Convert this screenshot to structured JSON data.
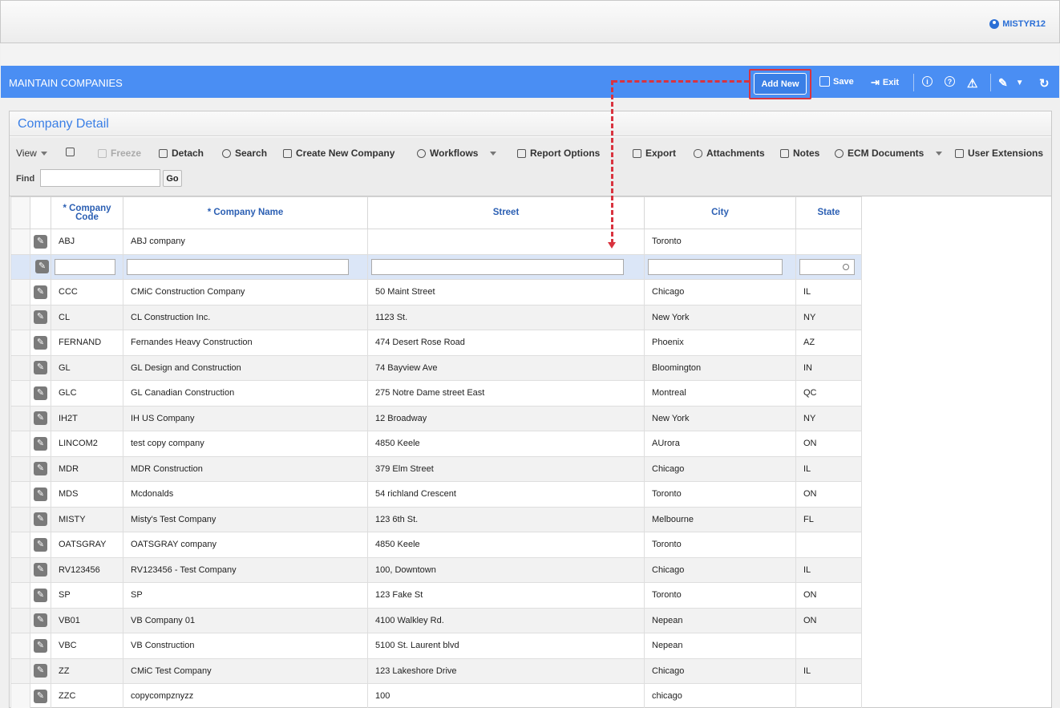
{
  "header": {
    "username": "MISTYR12"
  },
  "titlebar": {
    "title": "MAINTAIN COMPANIES",
    "add_new": "Add New",
    "save": "Save",
    "exit": "Exit"
  },
  "panel": {
    "title": "Company Detail"
  },
  "toolbar": {
    "view": "View",
    "freeze": "Freeze",
    "detach": "Detach",
    "search": "Search",
    "create_new_company": "Create New Company",
    "workflows": "Workflows",
    "report_options": "Report Options",
    "export": "Export",
    "attachments": "Attachments",
    "notes": "Notes",
    "ecm_documents": "ECM Documents",
    "user_extensions": "User Extensions",
    "find_label": "Find",
    "find_value": "",
    "go": "Go"
  },
  "table": {
    "columns": [
      "* Company Code",
      "* Company Name",
      "Street",
      "City",
      "State"
    ],
    "rows": [
      {
        "code": "ABJ",
        "name": "ABJ company",
        "street": "",
        "city": "Toronto",
        "state": ""
      },
      {
        "code": "CCC",
        "name": "CMiC Construction Company",
        "street": "50 Maint Street",
        "city": "Chicago",
        "state": "IL"
      },
      {
        "code": "CL",
        "name": "CL Construction Inc.",
        "street": "1123 St.",
        "city": "New York",
        "state": "NY"
      },
      {
        "code": "FERNAND",
        "name": "Fernandes Heavy Construction",
        "street": "474 Desert Rose Road",
        "city": "Phoenix",
        "state": "AZ"
      },
      {
        "code": "GL",
        "name": "GL Design and Construction",
        "street": "74 Bayview Ave",
        "city": "Bloomington",
        "state": "IN"
      },
      {
        "code": "GLC",
        "name": "GL Canadian Construction",
        "street": "275 Notre Dame street East",
        "city": "Montreal",
        "state": "QC"
      },
      {
        "code": "IH2T",
        "name": "IH US Company",
        "street": "12 Broadway",
        "city": "New York",
        "state": "NY"
      },
      {
        "code": "LINCOM2",
        "name": "test copy company",
        "street": "4850 Keele",
        "city": "AUrora",
        "state": "ON"
      },
      {
        "code": "MDR",
        "name": "MDR Construction",
        "street": "379 Elm Street",
        "city": "Chicago",
        "state": "IL"
      },
      {
        "code": "MDS",
        "name": "Mcdonalds",
        "street": "54 richland Crescent",
        "city": "Toronto",
        "state": "ON"
      },
      {
        "code": "MISTY",
        "name": "Misty's Test Company",
        "street": "123 6th St.",
        "city": "Melbourne",
        "state": "FL"
      },
      {
        "code": "OATSGRAY",
        "name": "OATSGRAY company",
        "street": "4850 Keele",
        "city": "Toronto",
        "state": ""
      },
      {
        "code": "RV123456",
        "name": "RV123456 - Test Company",
        "street": "100, Downtown",
        "city": "Chicago",
        "state": "IL"
      },
      {
        "code": "SP",
        "name": "SP",
        "street": "123 Fake St",
        "city": "Toronto",
        "state": "ON"
      },
      {
        "code": "VB01",
        "name": "VB Company 01",
        "street": "4100 Walkley Rd.",
        "city": "Nepean",
        "state": "ON"
      },
      {
        "code": "VBC",
        "name": "VB Construction",
        "street": "5100 St. Laurent blvd",
        "city": "Nepean",
        "state": ""
      },
      {
        "code": "ZZ",
        "name": "CMiC Test Company",
        "street": "123 Lakeshore Drive",
        "city": "Chicago",
        "state": "IL"
      },
      {
        "code": "ZZC",
        "name": "copycompznyzz",
        "street": "100",
        "city": "chicago",
        "state": ""
      }
    ]
  },
  "colors": {
    "accent": "#4a8ef3",
    "highlight": "#d9333f",
    "header_text": "#2b5fb3"
  }
}
